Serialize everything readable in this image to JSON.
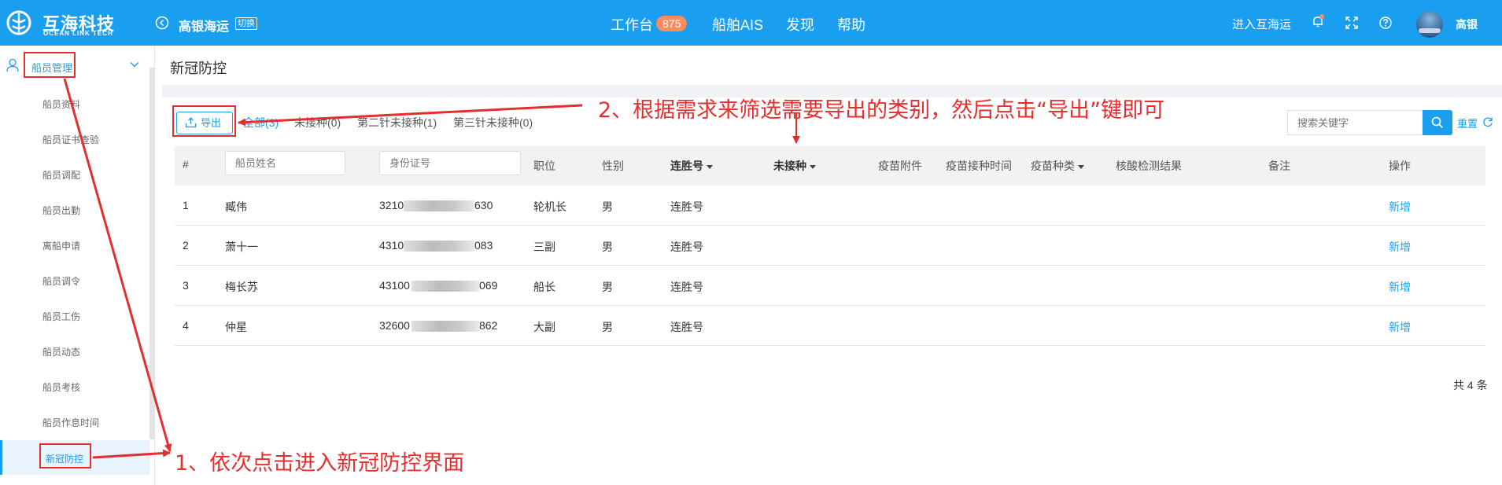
{
  "header": {
    "logo_title": "互海科技",
    "logo_subtitle": "OCEAN LINK TECH",
    "ship_name": "高银海运",
    "switch_label": "切换",
    "nav": [
      {
        "label": "工作台"
      },
      {
        "label": "船舶AIS"
      },
      {
        "label": "发现"
      },
      {
        "label": "帮助"
      }
    ],
    "workbench_badge": "875",
    "enter_label": "进入互海运",
    "user_name": "高银"
  },
  "sidebar": {
    "group_label": "船员管理",
    "items": [
      {
        "label": "船员资料"
      },
      {
        "label": "船员证书查验"
      },
      {
        "label": "船员调配"
      },
      {
        "label": "船员出勤"
      },
      {
        "label": "离船申请"
      },
      {
        "label": "船员调令"
      },
      {
        "label": "船员工伤"
      },
      {
        "label": "船员动态"
      },
      {
        "label": "船员考核"
      },
      {
        "label": "船员作息时间"
      },
      {
        "label": "新冠防控"
      }
    ]
  },
  "page": {
    "title": "新冠防控",
    "export_label": "导出",
    "tabs": [
      {
        "label": "全部(3)"
      },
      {
        "label": "未接种(0)"
      },
      {
        "label": "第二针未接种(1)"
      },
      {
        "label": "第三针未接种(0)"
      }
    ],
    "search_placeholder": "搜索关键字",
    "reset_label": "重置",
    "total_text": "共 4 条"
  },
  "table": {
    "columns": {
      "index": "#",
      "name_placeholder": "船员姓名",
      "id_placeholder": "身份证号",
      "position": "职位",
      "gender": "性别",
      "ship": "连胜号",
      "vaccine_status": "未接种",
      "attachment": "疫苗附件",
      "vaccine_time": "疫苗接种时间",
      "vaccine_type": "疫苗种类",
      "test_result": "核酸检测结果",
      "remark": "备注",
      "action": "操作"
    },
    "rows": [
      {
        "idx": "1",
        "name": "臧伟",
        "id_start": "3210",
        "id_end": "630",
        "position": "轮机长",
        "gender": "男",
        "ship": "连胜号",
        "action": "新增"
      },
      {
        "idx": "2",
        "name": "萧十一",
        "id_start": "4310",
        "id_end": "083",
        "position": "三副",
        "gender": "男",
        "ship": "连胜号",
        "action": "新增"
      },
      {
        "idx": "3",
        "name": "梅长苏",
        "id_start": "43100",
        "id_end": "069",
        "position": "船长",
        "gender": "男",
        "ship": "连胜号",
        "action": "新增"
      },
      {
        "idx": "4",
        "name": "仲星",
        "id_start": "32600",
        "id_end": "862",
        "position": "大副",
        "gender": "男",
        "ship": "连胜号",
        "action": "新增"
      }
    ]
  },
  "annotations": {
    "step1": "1、依次点击进入新冠防控界面",
    "step2": "2、根据需求来筛选需要导出的类别，然后点击“导出”键即可",
    "color": "#e62e2e"
  },
  "colors": {
    "primary": "#1a9ff0",
    "badge": "#f88d5f"
  }
}
